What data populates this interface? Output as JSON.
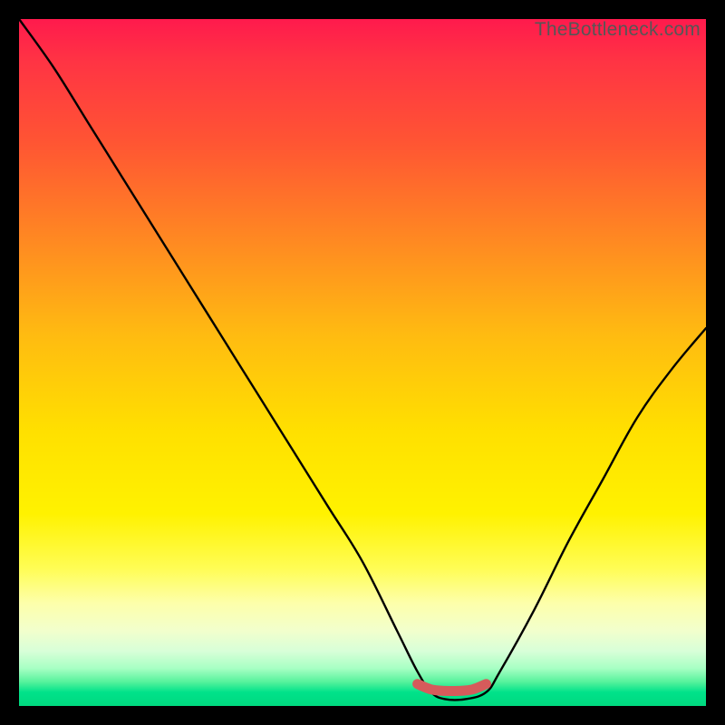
{
  "watermark": "TheBottleneck.com",
  "chart_data": {
    "type": "line",
    "title": "",
    "xlabel": "",
    "ylabel": "",
    "xlim": [
      0,
      100
    ],
    "ylim": [
      0,
      100
    ],
    "series": [
      {
        "name": "bottleneck-curve",
        "x": [
          0,
          5,
          10,
          15,
          20,
          25,
          30,
          35,
          40,
          45,
          50,
          55,
          58,
          60,
          62,
          65,
          68,
          70,
          75,
          80,
          85,
          90,
          95,
          100
        ],
        "values": [
          100,
          93,
          85,
          77,
          69,
          61,
          53,
          45,
          37,
          29,
          21,
          11,
          5,
          2,
          1,
          1,
          2,
          5,
          14,
          24,
          33,
          42,
          49,
          55
        ]
      },
      {
        "name": "optimal-marker",
        "x": [
          58,
          60,
          62,
          64,
          66,
          68
        ],
        "values": [
          3.2,
          2.4,
          2.2,
          2.2,
          2.4,
          3.2
        ]
      }
    ],
    "gradient_stops": [
      {
        "pos": 0,
        "color": "#ff1a4d"
      },
      {
        "pos": 0.18,
        "color": "#ff5533"
      },
      {
        "pos": 0.46,
        "color": "#ffbb11"
      },
      {
        "pos": 0.72,
        "color": "#fff200"
      },
      {
        "pos": 0.89,
        "color": "#f2ffcc"
      },
      {
        "pos": 0.98,
        "color": "#00e28a"
      },
      {
        "pos": 1.0,
        "color": "#00d97f"
      }
    ]
  }
}
